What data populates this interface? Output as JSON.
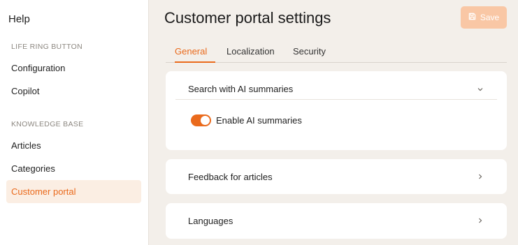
{
  "sidebar": {
    "title": "Help",
    "sections": [
      {
        "label": "LIFE RING BUTTON"
      },
      {
        "label": "KNOWLEDGE BASE"
      }
    ],
    "items": [
      {
        "label": "Configuration"
      },
      {
        "label": "Copilot"
      },
      {
        "label": "Articles"
      },
      {
        "label": "Categories"
      },
      {
        "label": "Customer portal"
      }
    ]
  },
  "header": {
    "title": "Customer portal settings",
    "save_label": "Save",
    "save_icon": "floppy-disk-icon"
  },
  "tabs": [
    {
      "label": "General",
      "active": true
    },
    {
      "label": "Localization",
      "active": false
    },
    {
      "label": "Security",
      "active": false
    }
  ],
  "cards": [
    {
      "title": "Search with AI summaries",
      "expanded": true,
      "toggle": {
        "label": "Enable AI summaries",
        "on": true
      }
    },
    {
      "title": "Feedback for articles",
      "expanded": false
    },
    {
      "title": "Languages",
      "expanded": false
    }
  ],
  "colors": {
    "accent": "#ea6a1c",
    "save_button_bg": "#f9c7a5",
    "active_item_bg": "#fbeee3",
    "page_bg": "#f3efea"
  }
}
